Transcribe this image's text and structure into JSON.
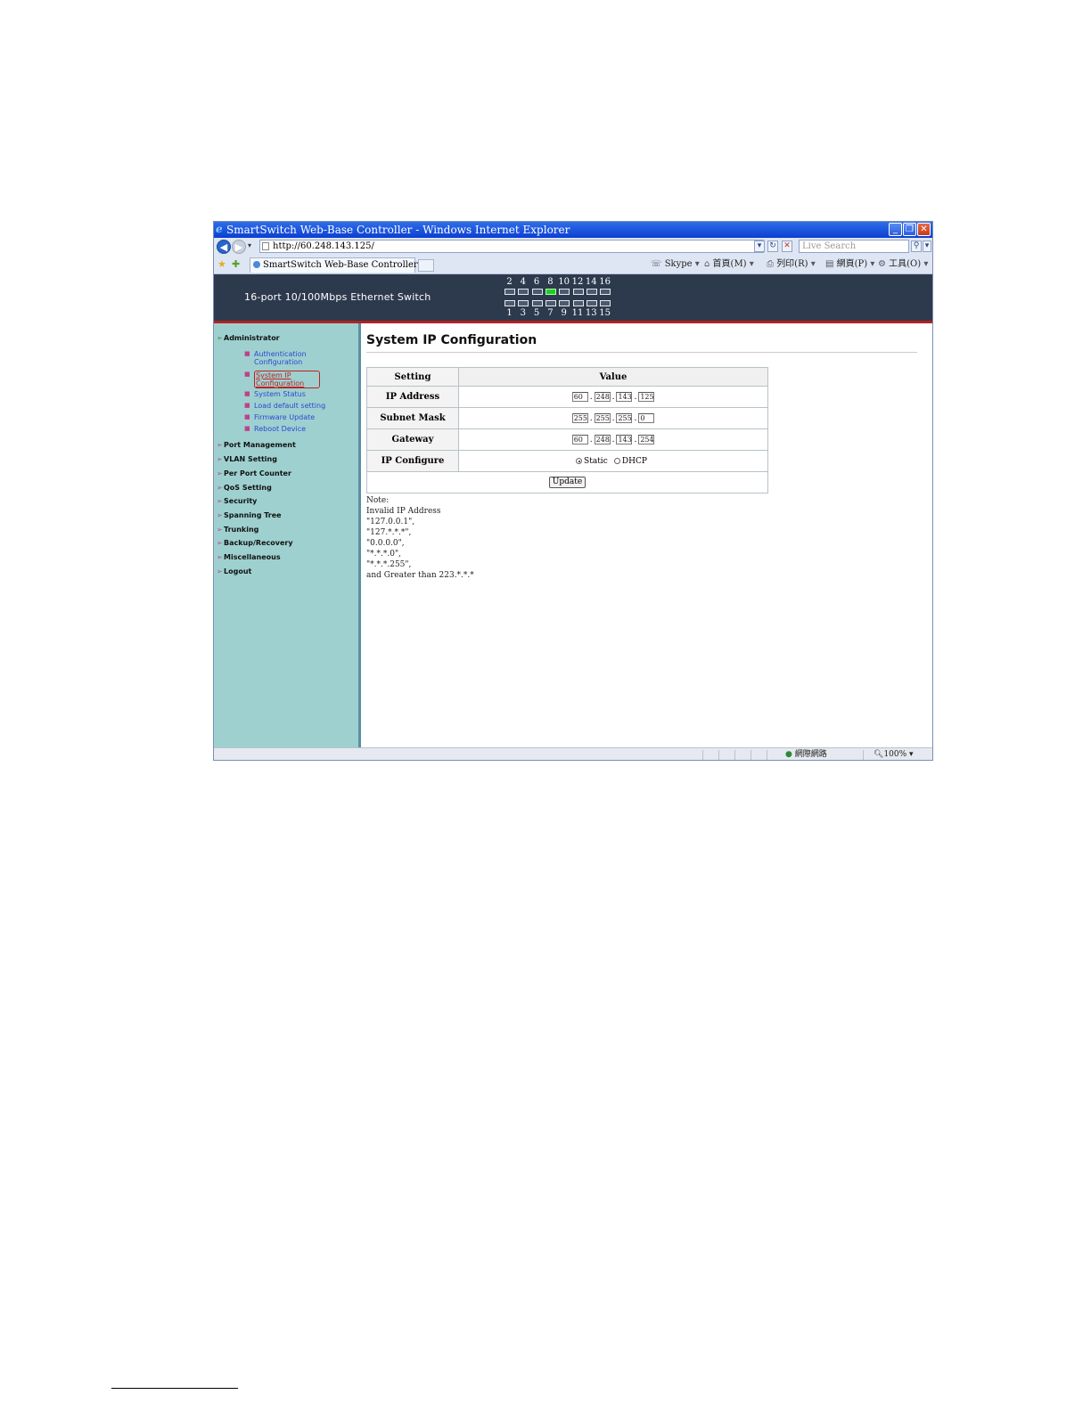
{
  "window": {
    "title": "SmartSwitch Web-Base Controller - Windows Internet Explorer",
    "minimize_glyph": "_",
    "restore_glyph": "❐",
    "close_glyph": "✕"
  },
  "addressbar": {
    "url": "http://60.248.143.125/",
    "search_placeholder": "Live Search",
    "back_glyph": "◀",
    "forward_glyph": "▶",
    "dropdown_glyph": "▾",
    "refresh_glyph": "↻",
    "stop_glyph": "✕",
    "search_glyph": "⚲"
  },
  "tabs": {
    "active_label": "SmartSwitch Web-Base Controller"
  },
  "commandbar": {
    "skype": "Skype",
    "home": "首頁(M)",
    "print": "列印(R)",
    "page": "網頁(P)",
    "tools": "工具(O)"
  },
  "banner": {
    "title": "16-port 10/100Mbps Ethernet Switch",
    "top_ports": [
      "2",
      "4",
      "6",
      "8",
      "10",
      "12",
      "14",
      "16"
    ],
    "bottom_ports": [
      "1",
      "3",
      "5",
      "7",
      "9",
      "11",
      "13",
      "15"
    ],
    "active_top_port": "8"
  },
  "sidebar": {
    "administrator": "Administrator",
    "sub_items": [
      "Authentication Configuration",
      "System IP Configuration",
      "System Status",
      "Load default setting",
      "Firmware Update",
      "Reboot Device"
    ],
    "current_sub_item": "System IP Configuration",
    "sections": [
      "Port Management",
      "VLAN Setting",
      "Per Port Counter",
      "QoS Setting",
      "Security",
      "Spanning Tree",
      "Trunking",
      "Backup/Recovery",
      "Miscellaneous",
      "Logout"
    ]
  },
  "main": {
    "title": "System IP Configuration",
    "table": {
      "col_setting": "Setting",
      "col_value": "Value",
      "ip_label": "IP Address",
      "ip": [
        "60",
        "248",
        "143",
        "125"
      ],
      "mask_label": "Subnet Mask",
      "mask": [
        "255",
        "255",
        "255",
        "0"
      ],
      "gateway_label": "Gateway",
      "gateway": [
        "60",
        "248",
        "143",
        "254"
      ],
      "ipconf_label": "IP Configure",
      "static_label": "Static",
      "dhcp_label": "DHCP",
      "selected_mode": "Static",
      "update_label": "Update"
    },
    "note_lines": [
      "Note:",
      "Invalid IP Address",
      "\"127.0.0.1\",",
      "\"127.*.*.*\",",
      "\"0.0.0.0\",",
      "\"*.*.*.0\",",
      "\"*.*.*.255\",",
      "and Greater than 223.*.*.*"
    ]
  },
  "statusbar": {
    "zone": "網際網路",
    "zoom": "100%"
  },
  "colors": {
    "banner_bg": "#2d3a4e",
    "sidebar_bg": "#9ed0d0",
    "active_port": "#22cc22",
    "accent_red": "#b22222"
  }
}
